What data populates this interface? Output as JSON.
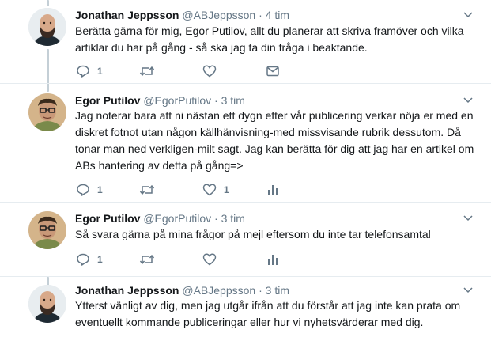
{
  "tweets": [
    {
      "name": "Jonathan Jeppsson",
      "handle": "@ABJeppsson",
      "separator": "·",
      "time": "4 tim",
      "text": "Berätta gärna för mig, Egor Putilov, allt du planerar att skriva framöver och vilka artiklar du har på gång - så ska jag ta din fråga i beaktande.",
      "reply_count": "1",
      "like_count": "",
      "actions": [
        "reply-icon",
        "retweet-icon",
        "like-icon",
        "message-icon"
      ]
    },
    {
      "name": "Egor Putilov",
      "handle": "@EgorPutilov",
      "separator": "·",
      "time": "3 tim",
      "text": "Jag noterar bara att ni nästan ett dygn efter vår publicering verkar nöja er med en diskret fotnot utan någon källhänvisning-med missvisande rubrik dessutom. Då tonar man ned verkligen-milt sagt. Jag kan berätta för dig att jag har en artikel om ABs hantering av detta på gång=>",
      "reply_count": "1",
      "like_count": "1",
      "actions": [
        "reply-icon",
        "retweet-icon",
        "like-icon",
        "analytics-icon"
      ]
    },
    {
      "name": "Egor Putilov",
      "handle": "@EgorPutilov",
      "separator": "·",
      "time": "3 tim",
      "text": "Så svara gärna på mina frågor på mejl eftersom du inte tar telefonsamtal",
      "reply_count": "1",
      "like_count": "",
      "actions": [
        "reply-icon",
        "retweet-icon",
        "like-icon",
        "analytics-icon"
      ]
    },
    {
      "name": "Jonathan Jeppsson",
      "handle": "@ABJeppsson",
      "separator": "·",
      "time": "3 tim",
      "text": "Ytterst vänligt av dig, men jag utgår ifrån att du förstår att jag inte kan prata om eventuellt kommande publiceringar eller hur vi nyhetsvärderar med dig.",
      "reply_count": "",
      "like_count": "",
      "actions": []
    }
  ],
  "colors": {
    "text": "#14171a",
    "secondary": "#657786",
    "thread_line": "#c4cfd6",
    "divider": "#e6ecf0"
  }
}
